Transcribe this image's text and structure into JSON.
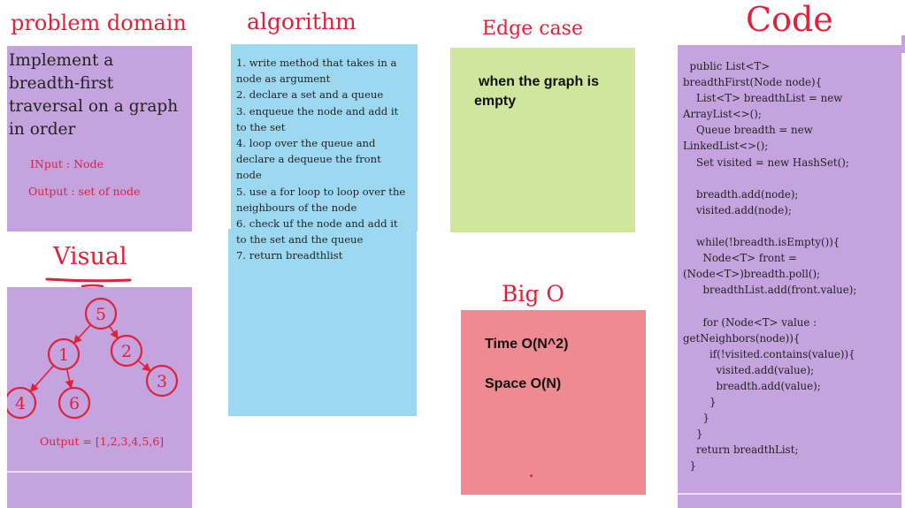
{
  "headings": {
    "problem_domain": "problem domain",
    "algorithm": "algorithm",
    "edge_case": "Edge case",
    "code": "Code",
    "visual": "Visual",
    "big_o": "Big O"
  },
  "problem_domain": {
    "description": "Implement a breadth-first traversal on a graph in order",
    "input": "INput : Node",
    "output": "Output : set of node"
  },
  "algorithm": {
    "steps": [
      "1. write method that takes in a node as argument",
      "2. declare a set and a queue",
      "3. enqueue the node and add it to the set",
      "4. loop over the queue and declare a dequeue the front node",
      "5. use a for loop to loop over the neighbours of the node",
      "6. check uf the node and add it to the set and the queue",
      "7. return breadthlist"
    ]
  },
  "edge_case": {
    "text": "when the graph is empty"
  },
  "visual": {
    "nodes": [
      {
        "id": "n5",
        "label": "5"
      },
      {
        "id": "n1",
        "label": "1"
      },
      {
        "id": "n2",
        "label": "2"
      },
      {
        "id": "n3",
        "label": "3"
      },
      {
        "id": "n4",
        "label": "4"
      },
      {
        "id": "n6",
        "label": "6"
      }
    ],
    "edges": [
      {
        "from": "n5",
        "to": "n1"
      },
      {
        "from": "n5",
        "to": "n2"
      },
      {
        "from": "n1",
        "to": "n4"
      },
      {
        "from": "n1",
        "to": "n6"
      },
      {
        "from": "n2",
        "to": "n3"
      }
    ],
    "output": "Output = [1,2,3,4,5,6]"
  },
  "big_o": {
    "time": "Time O(N^2)",
    "space": "Space O(N)"
  },
  "code": {
    "lines": [
      "  public List<T>",
      "breadthFirst(Node node){",
      "    List<T> breadthList = new",
      "ArrayList<>();",
      "    Queue breadth = new",
      "LinkedList<>();",
      "    Set visited = new HashSet();",
      "",
      "    breadth.add(node);",
      "    visited.add(node);",
      "",
      "    while(!breadth.isEmpty()){",
      "      Node<T> front =",
      "(Node<T>)breadth.poll();",
      "      breadthList.add(front.value);",
      "",
      "      for (Node<T> value :",
      "getNeighbors(node)){",
      "        if(!visited.contains(value)){",
      "          visited.add(value);",
      "          breadth.add(value);",
      "        }",
      "      }",
      "    }",
      "    return breadthList;",
      "  }"
    ]
  }
}
